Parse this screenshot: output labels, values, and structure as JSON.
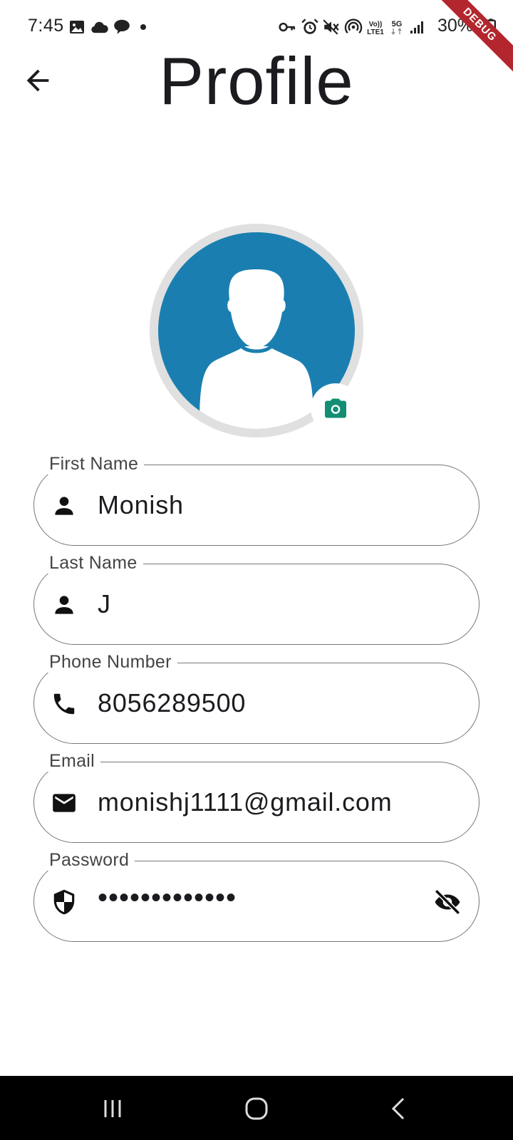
{
  "status_bar": {
    "time": "7:45",
    "battery": "30%",
    "icons": [
      "image-icon",
      "cloud-icon",
      "chat-icon",
      "dot-icon",
      "vpn-key-icon",
      "alarm-icon",
      "mute-icon",
      "hotspot-icon",
      "volte-icon",
      "5g-icon",
      "signal-icon",
      "battery-icon"
    ],
    "debug_label": "DEBUG"
  },
  "app_bar": {
    "back_icon": "arrow-back-icon",
    "title": "Profile"
  },
  "avatar": {
    "icon": "person-silhouette-icon",
    "camera_icon": "camera-icon",
    "accent_color": "#1a7fb0",
    "camera_color": "#138d75"
  },
  "form": {
    "first_name": {
      "label": "First Name",
      "value": "Monish",
      "icon": "person-icon"
    },
    "last_name": {
      "label": "Last Name",
      "value": "J",
      "icon": "person-icon"
    },
    "phone": {
      "label": "Phone Number",
      "value": "8056289500",
      "icon": "phone-icon"
    },
    "email": {
      "label": "Email",
      "value": "monishj1111@gmail.com",
      "icon": "mail-icon"
    },
    "password": {
      "label": "Password",
      "value": "•••••••••••••",
      "icon": "shield-icon",
      "toggle_icon": "visibility-off-icon"
    }
  },
  "nav_bar": {
    "buttons": [
      "recents-icon",
      "home-icon",
      "back-icon"
    ]
  }
}
